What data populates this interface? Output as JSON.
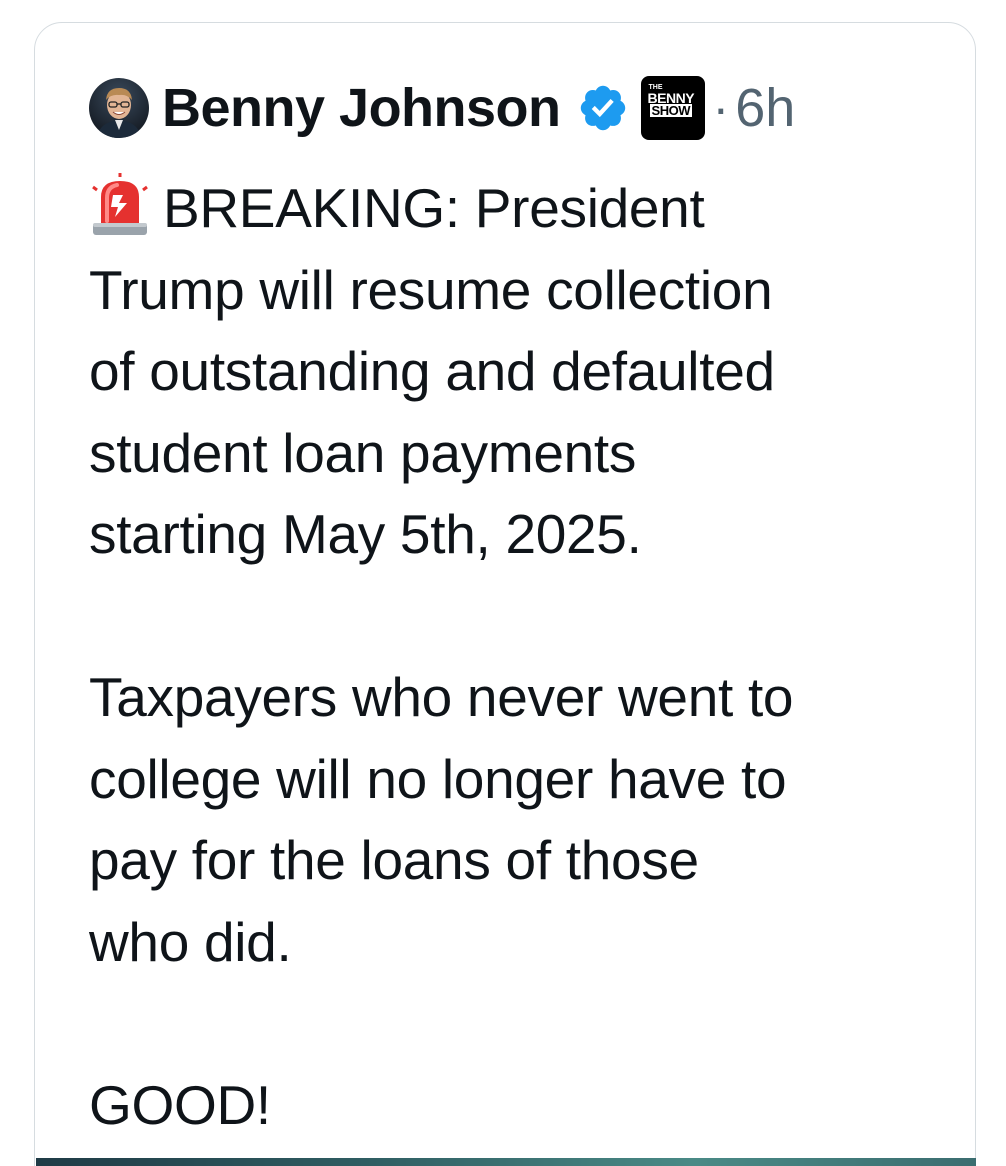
{
  "tweet": {
    "author_name": "Benny Johnson",
    "verified": true,
    "affiliate_badge": {
      "small_text": "THE",
      "line1": "BENNY",
      "line2": "SHOW"
    },
    "separator": "·",
    "timestamp": "6h",
    "icons": {
      "avatar": "author-avatar",
      "verified": "verified-badge-icon",
      "siren": "police-siren-emoji"
    },
    "text_lines": [
      "BREAKING: President",
      "Trump will resume collection",
      "of outstanding and defaulted",
      "student loan payments",
      "starting May 5th, 2025.",
      "",
      "Taxpayers who never went to",
      "college will no longer have to",
      "pay for the loans of those",
      "who did.",
      "",
      "GOOD!"
    ]
  },
  "colors": {
    "text_primary": "#0f1419",
    "text_secondary": "#536471",
    "verified_blue": "#1d9bf0",
    "card_border": "#d6dce0"
  }
}
